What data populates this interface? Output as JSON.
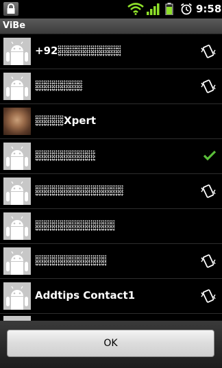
{
  "status_bar": {
    "time": "9:58",
    "icons": [
      "lock-icon",
      "wifi-icon",
      "signal-icon",
      "battery-icon",
      "alarm-icon"
    ]
  },
  "app": {
    "title": "ViBe"
  },
  "contacts": [
    {
      "name_prefix": "+92",
      "name_suffix": "",
      "redacted": true,
      "avatar": "android-default",
      "status": "vibrate-icon"
    },
    {
      "name_prefix": "",
      "name_suffix": "",
      "redacted": true,
      "avatar": "android-default",
      "status": "vibrate-icon"
    },
    {
      "name_prefix": "",
      "name_suffix": "Xpert",
      "redacted": true,
      "avatar": "photo",
      "status": ""
    },
    {
      "name_prefix": "",
      "name_suffix": "",
      "redacted": true,
      "avatar": "android-default",
      "status": "check-icon"
    },
    {
      "name_prefix": "",
      "name_suffix": "",
      "redacted": true,
      "avatar": "android-default",
      "status": "vibrate-icon"
    },
    {
      "name_prefix": "",
      "name_suffix": "",
      "redacted": true,
      "avatar": "android-default",
      "status": ""
    },
    {
      "name_prefix": "",
      "name_suffix": "",
      "redacted": true,
      "avatar": "android-default",
      "status": "vibrate-icon"
    },
    {
      "name_prefix": "Addtips Contact1",
      "name_suffix": "",
      "redacted": false,
      "avatar": "android-default",
      "status": "vibrate-icon"
    }
  ],
  "ok_button": {
    "label": "OK"
  },
  "colors": {
    "check": "#5bbf3a",
    "battery": "#8ee02a",
    "wifi": "#8ee02a"
  }
}
